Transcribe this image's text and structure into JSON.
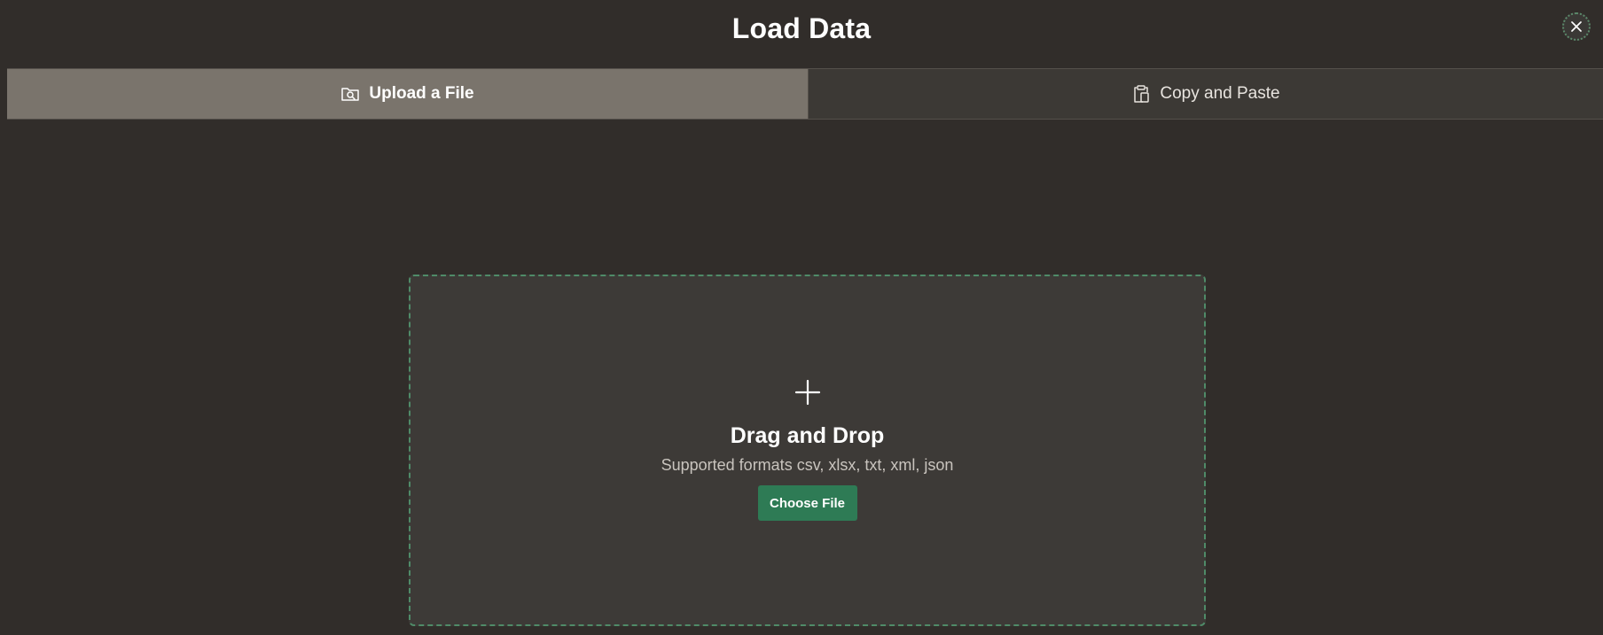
{
  "dialog": {
    "title": "Load Data"
  },
  "tabs": [
    {
      "label": "Upload a File",
      "icon": "folder-search-icon",
      "selected": true
    },
    {
      "label": "Copy and Paste",
      "icon": "clipboard-icon",
      "selected": false
    }
  ],
  "dropzone": {
    "icon": "plus-icon",
    "title": "Drag and Drop",
    "subtitle": "Supported formats csv, xlsx, txt, xml, json",
    "button_label": "Choose File"
  },
  "colors": {
    "background": "#312d2a",
    "active_tab": "#7a746c",
    "inactive_tab": "#3c3935",
    "dropzone": "#3d3a37",
    "accent": "#2e7b55"
  }
}
